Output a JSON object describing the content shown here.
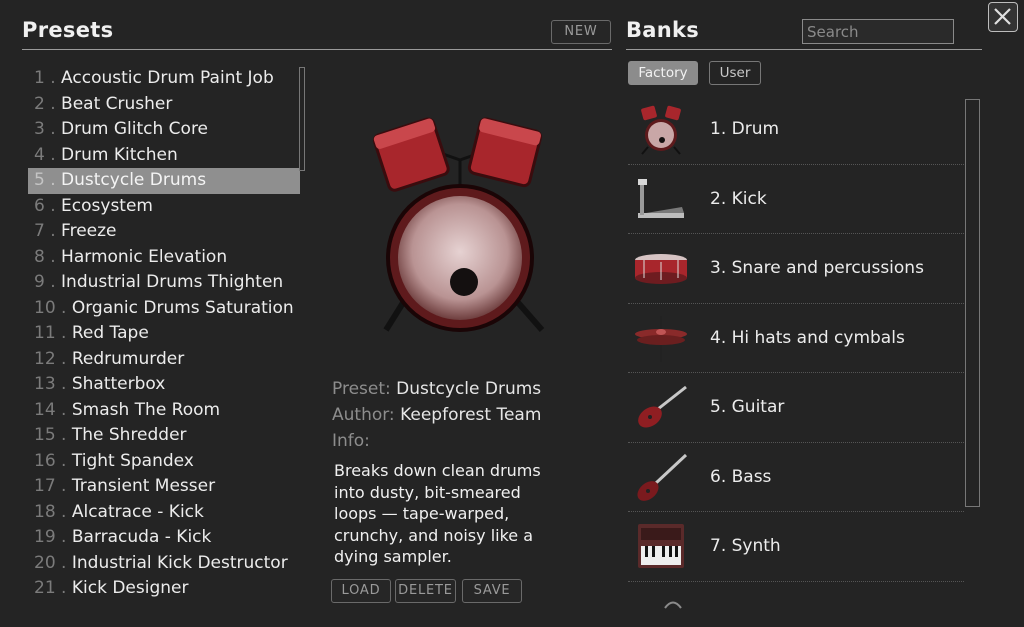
{
  "presets": {
    "title": "Presets",
    "new_label": "NEW",
    "items": [
      {
        "num": "1",
        "name": "Accoustic Drum Paint Job"
      },
      {
        "num": "2",
        "name": "Beat Crusher"
      },
      {
        "num": "3",
        "name": "Drum Glitch Core"
      },
      {
        "num": "4",
        "name": "Drum Kitchen"
      },
      {
        "num": "5",
        "name": "Dustcycle Drums"
      },
      {
        "num": "6",
        "name": "Ecosystem"
      },
      {
        "num": "7",
        "name": "Freeze"
      },
      {
        "num": "8",
        "name": "Harmonic Elevation"
      },
      {
        "num": "9",
        "name": "Industrial Drums Thighten"
      },
      {
        "num": "10",
        "name": "Organic Drums Saturation"
      },
      {
        "num": "11",
        "name": "Red Tape"
      },
      {
        "num": "12",
        "name": "Redrumurder"
      },
      {
        "num": "13",
        "name": "Shatterbox"
      },
      {
        "num": "14",
        "name": "Smash The Room"
      },
      {
        "num": "15",
        "name": "The Shredder"
      },
      {
        "num": "16",
        "name": "Tight Spandex"
      },
      {
        "num": "17",
        "name": "Transient Messer"
      },
      {
        "num": "18",
        "name": "Alcatrace - Kick"
      },
      {
        "num": "19",
        "name": "Barracuda - Kick"
      },
      {
        "num": "20",
        "name": "Industrial Kick Destructor"
      },
      {
        "num": "21",
        "name": "Kick Designer"
      }
    ],
    "selected_index": 4
  },
  "details": {
    "preset_label": "Preset:",
    "preset_value": "Dustcycle Drums",
    "author_label": "Author:",
    "author_value": "Keepforest Team",
    "info_label": "Info:",
    "info_text": "Breaks down clean drums into dusty, bit-smeared loops — tape-warped, crunchy, and noisy like a dying sampler.",
    "load_label": "LOAD",
    "delete_label": "DELETE",
    "save_label": "SAVE"
  },
  "banks": {
    "title": "Banks",
    "search_placeholder": "Search",
    "tabs": [
      {
        "label": "Factory",
        "active": true
      },
      {
        "label": "User",
        "active": false
      }
    ],
    "items": [
      {
        "label": "1. Drum",
        "icon": "drum-kit-icon"
      },
      {
        "label": "2. Kick",
        "icon": "kick-pedal-icon"
      },
      {
        "label": "3. Snare and percussions",
        "icon": "snare-drum-icon"
      },
      {
        "label": "4. Hi hats and cymbals",
        "icon": "cymbal-icon"
      },
      {
        "label": "5. Guitar",
        "icon": "guitar-icon"
      },
      {
        "label": "6. Bass",
        "icon": "bass-guitar-icon"
      },
      {
        "label": "7. Synth",
        "icon": "synth-keyboard-icon"
      }
    ]
  },
  "colors": {
    "background": "#242424",
    "selection": "#8f8f8f",
    "accent_red": "#a8262c"
  }
}
